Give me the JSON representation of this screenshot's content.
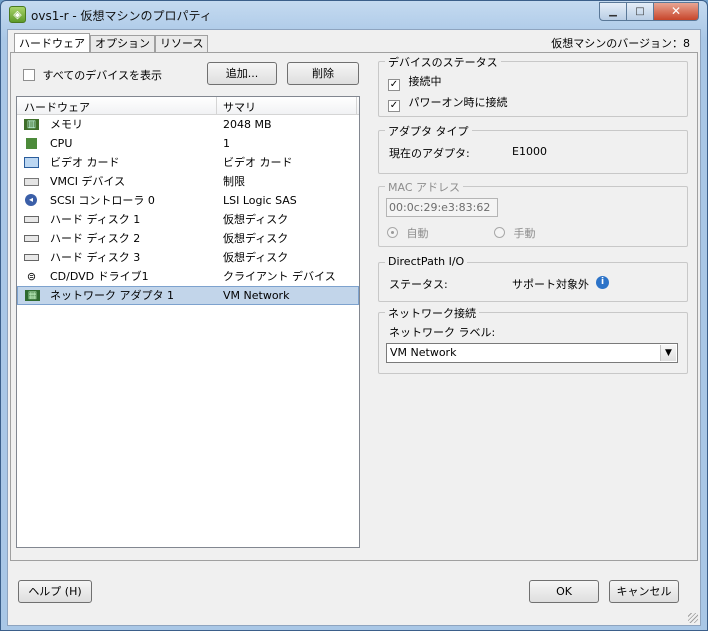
{
  "window": {
    "title": "ovs1-r - 仮想マシンのプロパティ",
    "app_icon": "vsphere-icon"
  },
  "tabs": [
    {
      "label": "ハードウェア",
      "active": true
    },
    {
      "label": "オプション",
      "active": false
    },
    {
      "label": "リソース",
      "active": false
    }
  ],
  "version_label": "仮想マシンのバージョン：8",
  "hardware": {
    "show_all_devices_label": "すべてのデバイスを表示",
    "add_button": "追加...",
    "remove_button": "削除",
    "columns": [
      "ハードウェア",
      "サマリ"
    ],
    "items": [
      {
        "name": "メモリ",
        "summary": "2048 MB",
        "icon": "memory-icon",
        "selected": false
      },
      {
        "name": "CPU",
        "summary": "1",
        "icon": "cpu-icon",
        "selected": false
      },
      {
        "name": "ビデオ カード",
        "summary": "ビデオ カード",
        "icon": "video-card-icon",
        "selected": false
      },
      {
        "name": "VMCI デバイス",
        "summary": "制限",
        "icon": "vmci-device-icon",
        "selected": false
      },
      {
        "name": "SCSI コントローラ 0",
        "summary": "LSI Logic SAS",
        "icon": "scsi-controller-icon",
        "selected": false
      },
      {
        "name": "ハード ディスク 1",
        "summary": "仮想ディスク",
        "icon": "hard-disk-icon",
        "selected": false
      },
      {
        "name": "ハード ディスク 2",
        "summary": "仮想ディスク",
        "icon": "hard-disk-icon",
        "selected": false
      },
      {
        "name": "ハード ディスク 3",
        "summary": "仮想ディスク",
        "icon": "hard-disk-icon",
        "selected": false
      },
      {
        "name": "CD/DVD ドライブ1",
        "summary": "クライアント デバイス",
        "icon": "cd-dvd-icon",
        "selected": false
      },
      {
        "name": "ネットワーク アダプタ 1",
        "summary": "VM Network",
        "icon": "network-adapter-icon",
        "selected": true
      }
    ]
  },
  "device_status": {
    "title": "デバイスのステータス",
    "connected_label": "接続中",
    "connect_at_power_on_label": "パワーオン時に接続",
    "connected": true,
    "connect_at_power_on": true
  },
  "adapter_type": {
    "title": "アダプタ タイプ",
    "current_label": "現在のアダプタ:",
    "current_value": "E1000"
  },
  "mac_address": {
    "title": "MAC アドレス",
    "value": "00:0c:29:e3:83:62",
    "auto_label": "自動",
    "manual_label": "手動",
    "auto_selected": true
  },
  "directpath": {
    "title": "DirectPath I/O",
    "status_label": "ステータス:",
    "status_value": "サポート対象外"
  },
  "network_connection": {
    "title": "ネットワーク接続",
    "label": "ネットワーク ラベル:",
    "selected": "VM Network"
  },
  "footer": {
    "help_button": "ヘルプ (H)",
    "ok_button": "OK",
    "cancel_button": "キャンセル"
  },
  "colors": {
    "selection": "#c2d5ea",
    "info": "#2c73c8"
  }
}
